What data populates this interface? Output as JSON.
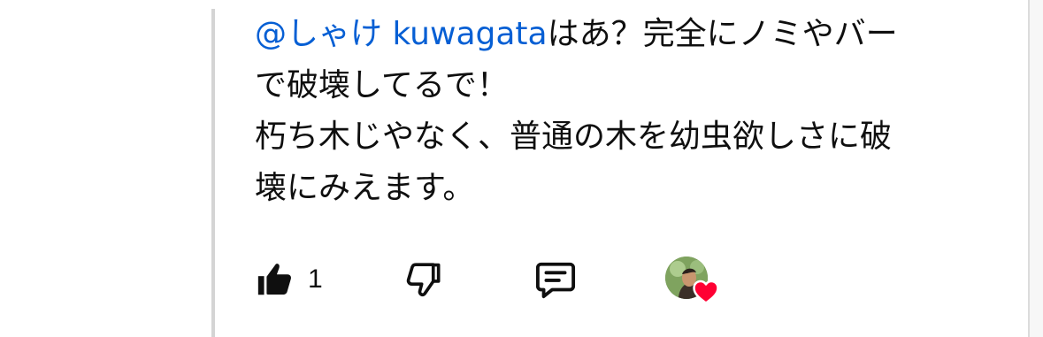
{
  "comment": {
    "mention": "@しゃけ kuwagata",
    "lines": [
      "はあ？完全にノミやバー",
      "で破壊してるで！",
      "朽ち木じやなく、普通の木を幼虫欲しさに破",
      "壊にみえます。"
    ]
  },
  "actions": {
    "like_count": "1",
    "like_icon": "thumbs-up-icon",
    "dislike_icon": "thumbs-down-icon",
    "reply_icon": "reply-comment-icon",
    "creator_heart_icon": "creator-heart-icon",
    "heart_color": "#ff0033"
  },
  "colors": {
    "mention": "#065fd4",
    "text": "#0f0f0f",
    "thread_line": "#d4d4d4"
  }
}
